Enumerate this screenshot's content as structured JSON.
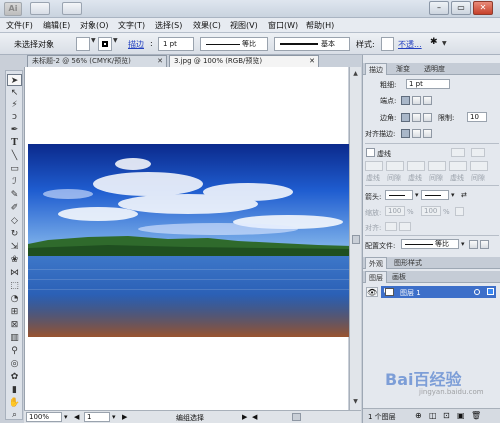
{
  "app": {
    "logo": "Ai",
    "window_controls": {
      "minimize": "–",
      "restore": "▭",
      "close": "✕"
    }
  },
  "menubar": {
    "items": [
      "文件(F)",
      "编辑(E)",
      "对象(O)",
      "文字(T)",
      "选择(S)",
      "效果(C)",
      "视图(V)",
      "窗口(W)",
      "帮助(H)"
    ]
  },
  "controlbar": {
    "selection_label": "未选择对象",
    "stroke_link": "描边",
    "stroke_weight": "1 pt",
    "profile_label": "等比",
    "brush_label": "基本",
    "style_label": "样式:",
    "opacity_link": "不透..."
  },
  "tabs": [
    {
      "label": "未标题-2 @ 56% (CMYK/预览)"
    },
    {
      "label": "3.jpg @ 100% (RGB/预览)"
    }
  ],
  "statusbar": {
    "zoom": "100%",
    "artboard": "1",
    "mode": "编组选择"
  },
  "stroke_panel": {
    "tabs": [
      "描边",
      "渐变",
      "透明度"
    ],
    "weight_label": "粗细:",
    "weight_value": "1 pt",
    "cap_label": "端点:",
    "corner_label": "边角:",
    "limit_label": "限制:",
    "limit_value": "10",
    "align_label": "对齐描边:",
    "dashed_label": "虚线",
    "dash_labels": [
      "虚线",
      "间隙",
      "虚线",
      "间隙",
      "虚线",
      "间隙"
    ],
    "arrow_label": "箭头:",
    "scale_label": "缩放:",
    "scale_value_1": "100",
    "scale_value_2": "100",
    "pct": "%",
    "align_arrow_label": "对齐:",
    "profile_label": "配置文件:",
    "profile_value": "等比"
  },
  "appearance_panel": {
    "tabs": [
      "外观",
      "图形样式"
    ]
  },
  "layers_panel": {
    "tabs": [
      "图层",
      "画板"
    ],
    "layer_name": "图层 1",
    "count": "1 个图层"
  },
  "watermark": {
    "text": "Bai百经验",
    "subtext": "jingyan.baidu.com"
  },
  "colors": {
    "accent": "#3d6fc9",
    "link": "#2340c0",
    "chrome": "#c9cfd8"
  },
  "icons": {
    "tools": [
      "selection-arrow",
      "direct-selection",
      "magic-wand",
      "lasso",
      "pen",
      "type",
      "line",
      "rectangle",
      "paintbrush",
      "pencil",
      "blob-brush",
      "eraser",
      "rotate",
      "scale",
      "warp",
      "width",
      "free-transform",
      "shape-builder",
      "perspective",
      "mesh",
      "gradient",
      "eyedropper",
      "blend",
      "symbol-sprayer",
      "column-graph",
      "artboard",
      "slice",
      "hand",
      "zoom"
    ]
  }
}
